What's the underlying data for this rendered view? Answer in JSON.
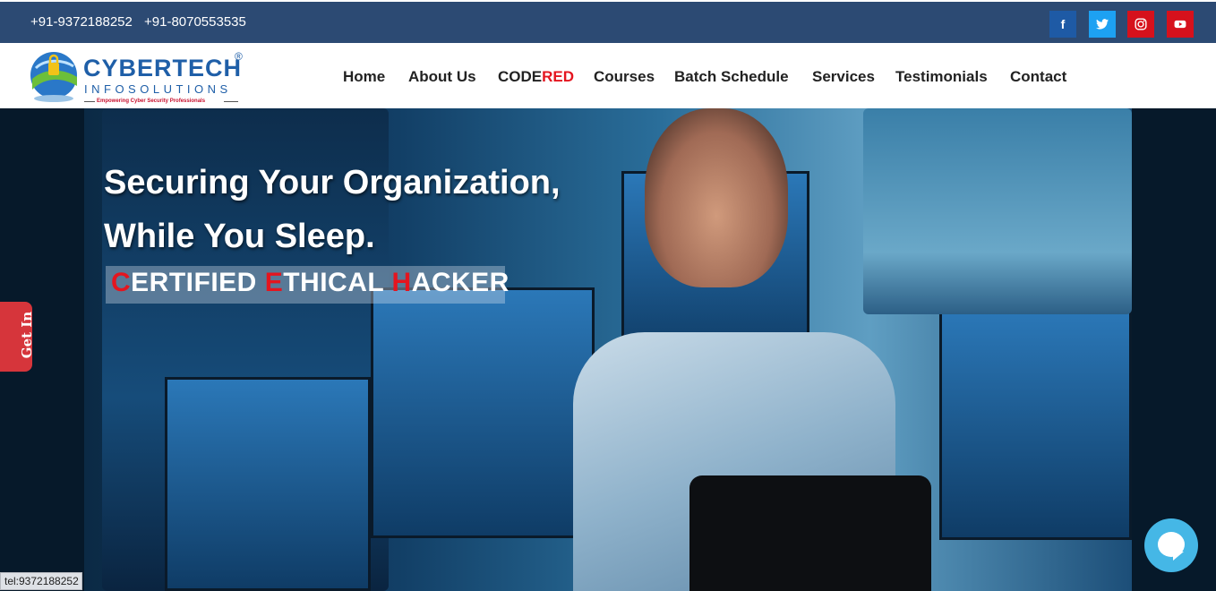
{
  "topbar": {
    "phone1": "+91-9372188252",
    "phone2": "+91-8070553535",
    "social": [
      {
        "name": "facebook-icon",
        "glyph": "f",
        "color": "#1e5aa5"
      },
      {
        "name": "twitter-icon",
        "glyph": "t",
        "color": "#1da1f2"
      },
      {
        "name": "instagram-icon",
        "glyph": "◎",
        "color": "#d6111c"
      },
      {
        "name": "youtube-icon",
        "glyph": "▶",
        "color": "#d6111c"
      }
    ]
  },
  "logo": {
    "word1": "CYBERTECH",
    "registered": "®",
    "word2": "INFOSOLUTIONS",
    "tagline": "Empowering Cyber Security Professionals"
  },
  "nav": {
    "home": "Home",
    "about": "About Us",
    "codered_prefix": "CODE",
    "codered_suffix": "RED",
    "courses": "Courses",
    "batch": "Batch Schedule",
    "services": "Services",
    "testimonials": "Testimonials",
    "contact": "Contact"
  },
  "hero": {
    "line1": "Securing Your Organization,",
    "line2": "While You Sleep.",
    "ceh": {
      "c": "C",
      "c_rest": "ERTIFIED ",
      "e": "E",
      "e_rest": "THICAL ",
      "h": "H",
      "h_rest": "ACKER"
    }
  },
  "side_tab": {
    "label": "Get In"
  },
  "status_bar": {
    "text": "tel:9372188252"
  },
  "colors": {
    "topbar": "#2c4a73",
    "accent_red": "#e4151f",
    "chat": "#45b7e6",
    "side_tab": "#d6353b"
  }
}
